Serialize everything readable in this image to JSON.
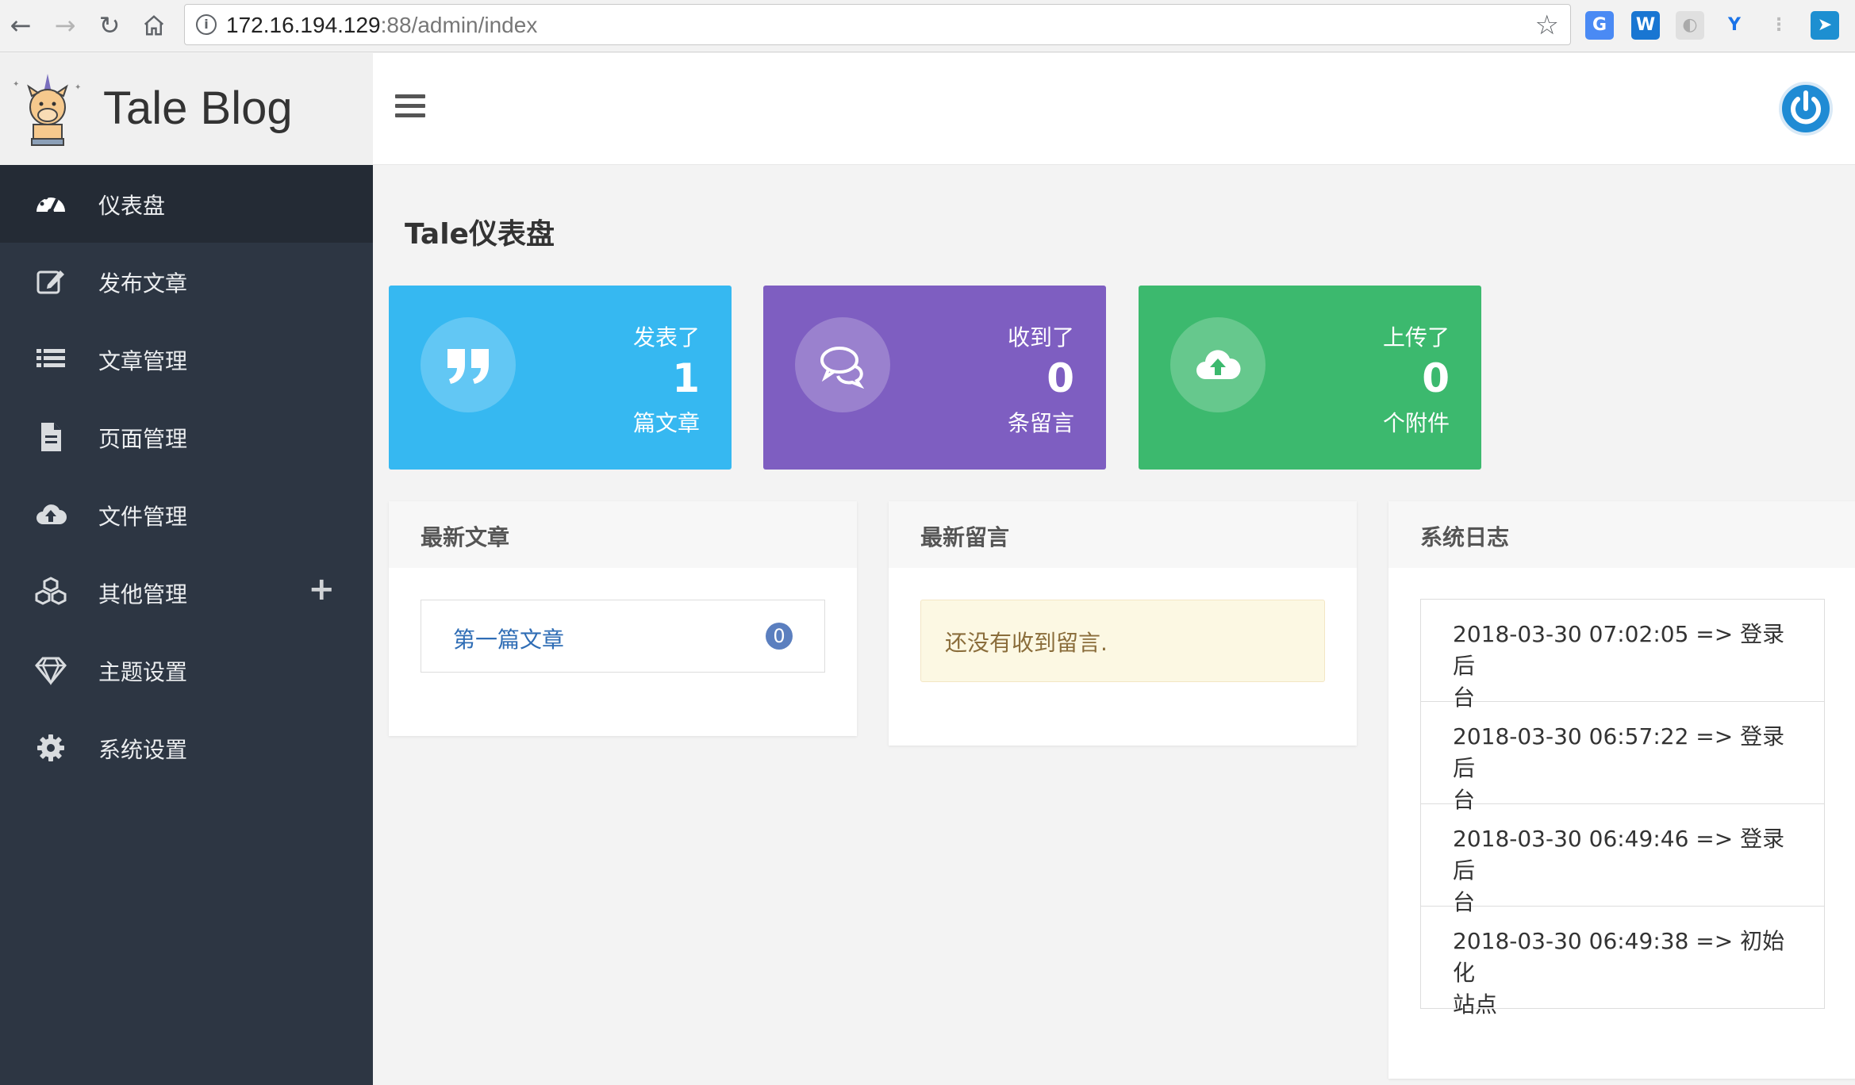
{
  "browser": {
    "url_host": "172.16.194.129",
    "url_rest": ":88/admin/index",
    "extensions": [
      "translate-icon",
      "w-extension-icon",
      "circle-extension-icon",
      "vue-devtools-icon",
      "tree-extension-icon",
      "send-extension-icon"
    ]
  },
  "header": {
    "brand_name": "Tale Blog"
  },
  "sidebar": {
    "items": [
      {
        "label": "仪表盘",
        "icon": "dashboard-icon",
        "active": true
      },
      {
        "label": "发布文章",
        "icon": "edit-icon"
      },
      {
        "label": "文章管理",
        "icon": "list-icon"
      },
      {
        "label": "页面管理",
        "icon": "file-icon"
      },
      {
        "label": "文件管理",
        "icon": "cloud-upload-icon"
      },
      {
        "label": "其他管理",
        "icon": "cubes-icon",
        "expand": "+"
      },
      {
        "label": "主题设置",
        "icon": "diamond-icon"
      },
      {
        "label": "系统设置",
        "icon": "gear-icon"
      }
    ]
  },
  "main": {
    "page_title": "Tale仪表盘",
    "stats": [
      {
        "top": "发表了",
        "value": "1",
        "bottom": "篇文章",
        "color": "#36b8f1",
        "icon": "quote-icon"
      },
      {
        "top": "收到了",
        "value": "0",
        "bottom": "条留言",
        "color": "#7e5ec1",
        "icon": "comments-icon"
      },
      {
        "top": "上传了",
        "value": "0",
        "bottom": "个附件",
        "color": "#3cb96e",
        "icon": "cloud-upload-icon"
      }
    ],
    "latest_posts": {
      "title": "最新文章",
      "items": [
        {
          "title": "第一篇文章",
          "comments": "0"
        }
      ]
    },
    "latest_comments": {
      "title": "最新留言",
      "empty_text": "还没有收到留言."
    },
    "system_logs": {
      "title": "系统日志",
      "items": [
        {
          "line1": "2018-03-30 07:02:05 => 登录后",
          "line2": "台"
        },
        {
          "line1": "2018-03-30 06:57:22 => 登录后",
          "line2": "台"
        },
        {
          "line1": "2018-03-30 06:49:46 => 登录后",
          "line2": "台"
        },
        {
          "line1": "2018-03-30 06:49:38 => 初始化",
          "line2": "站点"
        }
      ]
    }
  }
}
